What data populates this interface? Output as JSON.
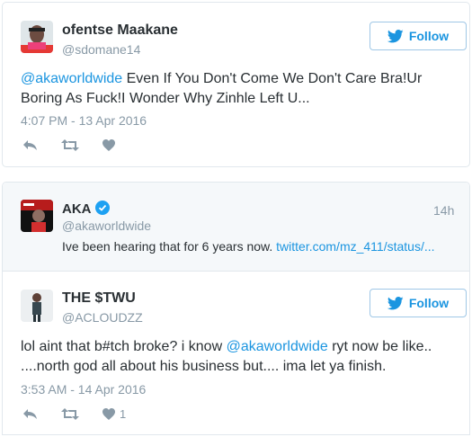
{
  "tweet1": {
    "name": "ofentse Maakane",
    "handle": "@sdomane14",
    "follow_label": "Follow",
    "mention": "@akaworldwide",
    "text_line1_rest": " Even If You Don't Come We Don't Care Bra!Ur",
    "text_line2": "Boring As Fuck!I Wonder Why Zinhle Left U...",
    "timestamp": "4:07 PM - 13 Apr 2016"
  },
  "quoted": {
    "name": "AKA",
    "handle": "@akaworldwide",
    "time_ago": "14h",
    "text": "Ive been hearing that for 6 years now. ",
    "link": "twitter.com/mz_411/status/..."
  },
  "tweet2": {
    "name": "THE $TWU",
    "handle": "@ACLOUDZZ",
    "follow_label": "Follow",
    "text_pre": "lol aint that b#tch broke? i know ",
    "mention": "@akaworldwide",
    "text_post": " ryt now be like..",
    "text_line2": "....north god all about his business but.... ima let ya finish.",
    "timestamp": "3:53 AM - 14 Apr 2016",
    "like_count": "1"
  },
  "colors": {
    "brand_blue": "#1b95e0",
    "muted": "#8899a6",
    "text": "#292f33",
    "border": "#e1e8ed"
  },
  "icons": [
    "twitter-bird-icon",
    "reply-icon",
    "retweet-icon",
    "heart-icon",
    "verified-icon"
  ]
}
